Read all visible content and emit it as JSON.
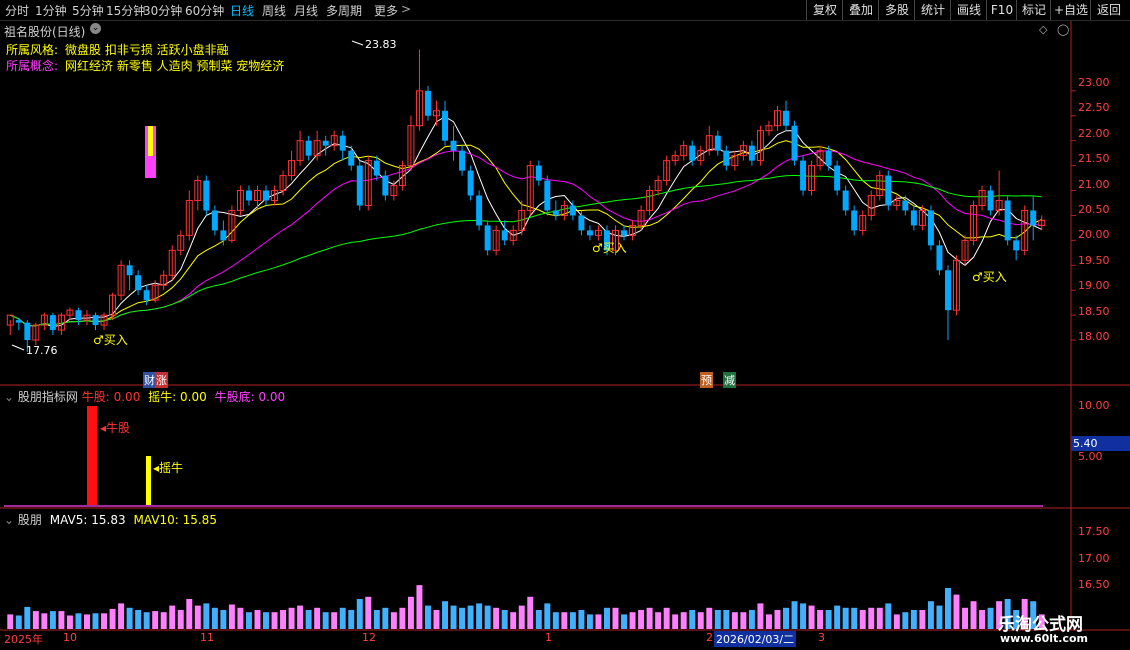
{
  "toolbar": {
    "periods": [
      "分时",
      "1分钟",
      "5分钟",
      "15分钟",
      "30分钟",
      "60分钟",
      "日线",
      "周线",
      "月线",
      "多周期",
      "更多"
    ],
    "active_period": "日线",
    "more_arrow": ">",
    "right_buttons": [
      "复权",
      "叠加",
      "多股",
      "统计",
      "画线",
      "F10",
      "标记",
      "+自选",
      "返回"
    ]
  },
  "main_panel": {
    "title": "祖名股份(日线)",
    "style_label": "所属风格:",
    "style_value": "微盘股 扣非亏损 活跃小盘非融",
    "concept_label": "所属概念:",
    "concept_value": "网红经济 新零售 人造肉 预制菜 宠物经济",
    "high_label": "23.83",
    "low_label": "17.76",
    "buy_signal": "买入",
    "event_markers": [
      "财",
      "涨",
      "预",
      "减"
    ],
    "price_ticks": [
      "23.00",
      "22.50",
      "22.00",
      "21.50",
      "21.00",
      "20.50",
      "20.00",
      "19.50",
      "19.00",
      "18.50",
      "18.00"
    ],
    "colors": {
      "up": "#ff3232",
      "down": "#00a8ff",
      "ma5": "#ffffff",
      "ma10": "#ffff00",
      "ma20": "#ff00ff",
      "ma60": "#00ff00"
    }
  },
  "indicator_panel": {
    "title": "股朋指标网",
    "niu_label": "牛股:",
    "niu_value": "0.00",
    "yaoniu_label": "摇牛:",
    "yaoniu_value": "0.00",
    "niudi_label": "牛股底:",
    "niudi_value": "0.00",
    "bar1_text": "牛股",
    "bar2_text": "摇牛",
    "ticks": [
      "10.00",
      "5.00"
    ],
    "current_value": "5.40"
  },
  "volume_panel": {
    "title": "股朋",
    "mav5_label": "MAV5:",
    "mav5_value": "15.83",
    "mav10_label": "MAV10:",
    "mav10_value": "15.85",
    "ticks": [
      "17.50",
      "17.00",
      "16.50"
    ]
  },
  "date_axis": {
    "labels": [
      "2025年",
      "10",
      "11",
      "12",
      "1",
      "2",
      "2026/02/03/二",
      "3"
    ]
  },
  "watermark": {
    "title": "乐淘公式网",
    "url": "www.60lt.com"
  },
  "chart_data": {
    "type": "candlestick",
    "y_range": [
      17.6,
      24.1
    ],
    "candles": [
      [
        18.3,
        18.5,
        18.1,
        18.4
      ],
      [
        18.4,
        18.35,
        18.2,
        18.45
      ],
      [
        18.35,
        18.0,
        17.76,
        18.4
      ],
      [
        18.0,
        18.3,
        17.9,
        18.35
      ],
      [
        18.3,
        18.5,
        18.2,
        18.55
      ],
      [
        18.5,
        18.2,
        18.1,
        18.55
      ],
      [
        18.2,
        18.5,
        18.1,
        18.55
      ],
      [
        18.5,
        18.6,
        18.4,
        18.65
      ],
      [
        18.6,
        18.4,
        18.3,
        18.65
      ],
      [
        18.4,
        18.5,
        18.3,
        18.6
      ],
      [
        18.5,
        18.3,
        18.2,
        18.55
      ],
      [
        18.3,
        18.5,
        18.2,
        18.55
      ],
      [
        18.5,
        18.9,
        18.4,
        18.95
      ],
      [
        18.9,
        19.5,
        18.8,
        19.6
      ],
      [
        19.5,
        19.3,
        19.0,
        19.6
      ],
      [
        19.3,
        19.0,
        18.9,
        19.4
      ],
      [
        19.0,
        18.8,
        18.7,
        19.1
      ],
      [
        18.8,
        19.1,
        18.75,
        19.2
      ],
      [
        19.1,
        19.3,
        19.0,
        19.4
      ],
      [
        19.3,
        19.8,
        19.2,
        19.9
      ],
      [
        19.8,
        20.1,
        19.7,
        20.2
      ],
      [
        20.1,
        20.8,
        20.0,
        21.0
      ],
      [
        20.8,
        21.2,
        20.6,
        21.3
      ],
      [
        21.2,
        20.6,
        20.5,
        21.3
      ],
      [
        20.6,
        20.2,
        20.1,
        20.7
      ],
      [
        20.2,
        20.0,
        19.9,
        20.4
      ],
      [
        20.0,
        20.6,
        19.95,
        20.7
      ],
      [
        20.6,
        21.0,
        20.5,
        21.1
      ],
      [
        21.0,
        20.8,
        20.7,
        21.1
      ],
      [
        20.8,
        21.0,
        20.6,
        21.1
      ],
      [
        21.0,
        20.8,
        20.7,
        21.1
      ],
      [
        20.8,
        21.0,
        20.7,
        21.1
      ],
      [
        21.0,
        21.3,
        20.9,
        21.4
      ],
      [
        21.3,
        21.6,
        21.2,
        21.8
      ],
      [
        21.6,
        22.0,
        21.5,
        22.2
      ],
      [
        22.0,
        21.7,
        21.6,
        22.1
      ],
      [
        21.7,
        22.0,
        21.6,
        22.2
      ],
      [
        22.0,
        21.9,
        21.7,
        22.1
      ],
      [
        21.9,
        22.1,
        21.8,
        22.2
      ],
      [
        22.1,
        21.8,
        21.6,
        22.2
      ],
      [
        21.8,
        21.5,
        21.4,
        21.9
      ],
      [
        21.5,
        20.7,
        20.6,
        21.6
      ],
      [
        20.7,
        21.6,
        20.6,
        21.7
      ],
      [
        21.6,
        21.3,
        21.2,
        21.7
      ],
      [
        21.3,
        20.9,
        20.8,
        21.4
      ],
      [
        20.9,
        21.1,
        20.8,
        21.2
      ],
      [
        21.1,
        21.5,
        21.0,
        21.6
      ],
      [
        21.5,
        22.3,
        21.4,
        22.5
      ],
      [
        22.3,
        23.0,
        22.2,
        23.83
      ],
      [
        23.0,
        22.5,
        22.4,
        23.1
      ],
      [
        22.5,
        22.6,
        22.3,
        22.8
      ],
      [
        22.6,
        22.0,
        21.9,
        22.8
      ],
      [
        22.0,
        21.8,
        21.6,
        22.3
      ],
      [
        21.8,
        21.4,
        21.3,
        21.9
      ],
      [
        21.4,
        20.9,
        20.8,
        21.5
      ],
      [
        20.9,
        20.3,
        20.2,
        21.0
      ],
      [
        20.3,
        19.8,
        19.7,
        20.4
      ],
      [
        19.8,
        20.2,
        19.7,
        20.3
      ],
      [
        20.2,
        20.0,
        19.9,
        20.4
      ],
      [
        20.0,
        20.2,
        19.9,
        20.3
      ],
      [
        20.2,
        20.6,
        20.1,
        20.8
      ],
      [
        20.6,
        21.5,
        20.5,
        21.6
      ],
      [
        21.5,
        21.2,
        21.1,
        21.6
      ],
      [
        21.2,
        20.6,
        20.5,
        21.3
      ],
      [
        20.6,
        20.5,
        20.4,
        20.8
      ],
      [
        20.5,
        20.7,
        20.4,
        20.8
      ],
      [
        20.7,
        20.5,
        20.4,
        20.8
      ],
      [
        20.5,
        20.2,
        20.1,
        20.6
      ],
      [
        20.2,
        20.1,
        20.0,
        20.3
      ],
      [
        20.1,
        20.2,
        20.0,
        20.3
      ],
      [
        20.2,
        19.8,
        19.7,
        20.3
      ],
      [
        19.8,
        20.2,
        19.7,
        20.3
      ],
      [
        20.2,
        20.1,
        20.0,
        20.3
      ],
      [
        20.1,
        20.3,
        20.0,
        20.4
      ],
      [
        20.3,
        20.6,
        20.2,
        20.7
      ],
      [
        20.6,
        21.0,
        20.5,
        21.1
      ],
      [
        21.0,
        21.2,
        20.9,
        21.3
      ],
      [
        21.2,
        21.6,
        21.1,
        21.7
      ],
      [
        21.6,
        21.7,
        21.5,
        21.8
      ],
      [
        21.7,
        21.9,
        21.6,
        22.0
      ],
      [
        21.9,
        21.6,
        21.5,
        22.0
      ],
      [
        21.6,
        21.8,
        21.5,
        21.9
      ],
      [
        21.8,
        22.1,
        21.7,
        22.3
      ],
      [
        22.1,
        21.8,
        21.7,
        22.2
      ],
      [
        21.8,
        21.5,
        21.4,
        21.9
      ],
      [
        21.5,
        21.7,
        21.4,
        21.8
      ],
      [
        21.7,
        21.9,
        21.6,
        22.0
      ],
      [
        21.9,
        21.6,
        21.5,
        22.0
      ],
      [
        21.6,
        22.2,
        21.5,
        22.3
      ],
      [
        22.2,
        22.3,
        22.1,
        22.4
      ],
      [
        22.3,
        22.6,
        22.2,
        22.7
      ],
      [
        22.6,
        22.3,
        22.2,
        22.8
      ],
      [
        22.3,
        21.6,
        21.5,
        22.4
      ],
      [
        21.6,
        21.0,
        20.9,
        21.7
      ],
      [
        21.0,
        21.5,
        20.9,
        21.6
      ],
      [
        21.5,
        21.8,
        21.4,
        21.9
      ],
      [
        21.8,
        21.5,
        21.4,
        21.9
      ],
      [
        21.5,
        21.0,
        20.9,
        21.6
      ],
      [
        21.0,
        20.6,
        20.5,
        21.1
      ],
      [
        20.6,
        20.2,
        20.1,
        20.7
      ],
      [
        20.2,
        20.5,
        20.1,
        20.6
      ],
      [
        20.5,
        20.9,
        20.4,
        21.0
      ],
      [
        20.9,
        21.3,
        20.8,
        21.4
      ],
      [
        21.3,
        20.7,
        20.6,
        21.4
      ],
      [
        20.7,
        20.8,
        20.6,
        20.9
      ],
      [
        20.8,
        20.6,
        20.5,
        20.9
      ],
      [
        20.6,
        20.3,
        20.2,
        20.7
      ],
      [
        20.3,
        20.6,
        20.2,
        20.7
      ],
      [
        20.6,
        19.9,
        19.8,
        20.7
      ],
      [
        19.9,
        19.4,
        19.3,
        20.0
      ],
      [
        19.4,
        18.6,
        18.0,
        19.5
      ],
      [
        18.6,
        19.6,
        18.5,
        19.7
      ],
      [
        19.6,
        20.0,
        19.5,
        20.1
      ],
      [
        20.0,
        20.7,
        19.9,
        20.8
      ],
      [
        20.7,
        21.0,
        20.6,
        21.1
      ],
      [
        21.0,
        20.6,
        20.5,
        21.1
      ],
      [
        20.6,
        20.8,
        20.5,
        21.4
      ],
      [
        20.8,
        20.0,
        19.9,
        20.9
      ],
      [
        20.0,
        19.8,
        19.6,
        20.1
      ],
      [
        19.8,
        20.6,
        19.7,
        20.7
      ],
      [
        20.6,
        20.3,
        20.0,
        20.9
      ],
      [
        20.3,
        20.4,
        20.2,
        20.5
      ]
    ]
  }
}
